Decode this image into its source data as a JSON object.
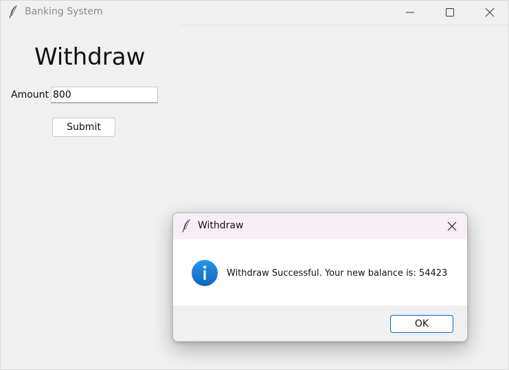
{
  "window": {
    "title": "Banking System",
    "app_icon": "feather-icon",
    "controls": [
      "minimize-icon",
      "maximize-icon",
      "close-icon"
    ]
  },
  "form": {
    "heading": "Withdraw",
    "amount_label": "Amount",
    "amount_value": "800",
    "submit_label": "Submit"
  },
  "dialog": {
    "title": "Withdraw",
    "icon": "info-icon",
    "message": "Withdraw Successful. Your new balance is: 54423",
    "ok_label": "OK"
  },
  "colors": {
    "window_bg": "#f0f0f0",
    "dialog_title_bg": "#f7eef6",
    "accent": "#0067c0",
    "info_blue": "#1a7fd6"
  }
}
